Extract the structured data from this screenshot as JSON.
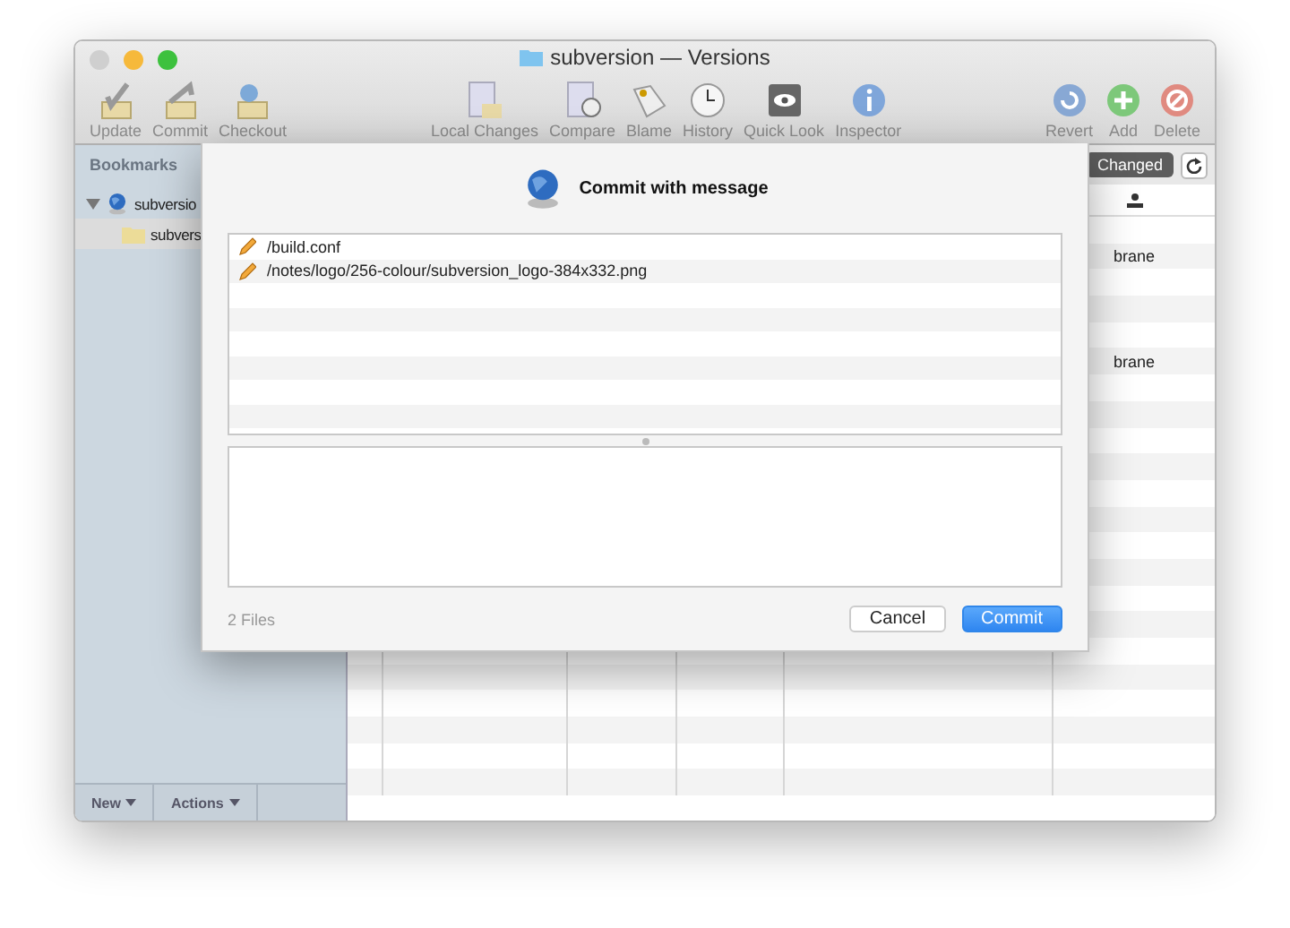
{
  "window": {
    "title": "subversion — Versions"
  },
  "toolbar": {
    "left": [
      {
        "label": "Update",
        "kind": "update"
      },
      {
        "label": "Commit",
        "kind": "commit"
      },
      {
        "label": "Checkout",
        "kind": "checkout"
      }
    ],
    "center": [
      {
        "label": "Local Changes",
        "kind": "changes"
      },
      {
        "label": "Compare",
        "kind": "compare"
      },
      {
        "label": "Blame",
        "kind": "blame"
      },
      {
        "label": "History",
        "kind": "history"
      },
      {
        "label": "Quick Look",
        "kind": "quicklook"
      },
      {
        "label": "Inspector",
        "kind": "inspector"
      }
    ],
    "right": [
      {
        "label": "Revert",
        "kind": "revert"
      },
      {
        "label": "Add",
        "kind": "add"
      },
      {
        "label": "Delete",
        "kind": "delete"
      }
    ]
  },
  "sidebar": {
    "header": "Bookmarks",
    "items": [
      {
        "label": "subversio",
        "expanded": true,
        "selected": false,
        "children": [
          {
            "label": "subvers",
            "selected": true
          }
        ]
      }
    ],
    "buttons": [
      "New",
      "Actions"
    ]
  },
  "filter": {
    "label": "Changed",
    "selected": true
  },
  "table": {
    "rows": [
      {},
      {
        "column_6": "brane"
      },
      {},
      {},
      {},
      {
        "column_6": "brane"
      }
    ]
  },
  "dialog": {
    "title": "Commit with message",
    "files": [
      {
        "path": "/build.conf"
      },
      {
        "path": "/notes/logo/256-colour/subversion_logo-384x332.png"
      }
    ],
    "count": "2 Files",
    "buttons": [
      {
        "label": "Cancel",
        "default": false
      },
      {
        "label": "Commit",
        "default": true
      }
    ]
  }
}
